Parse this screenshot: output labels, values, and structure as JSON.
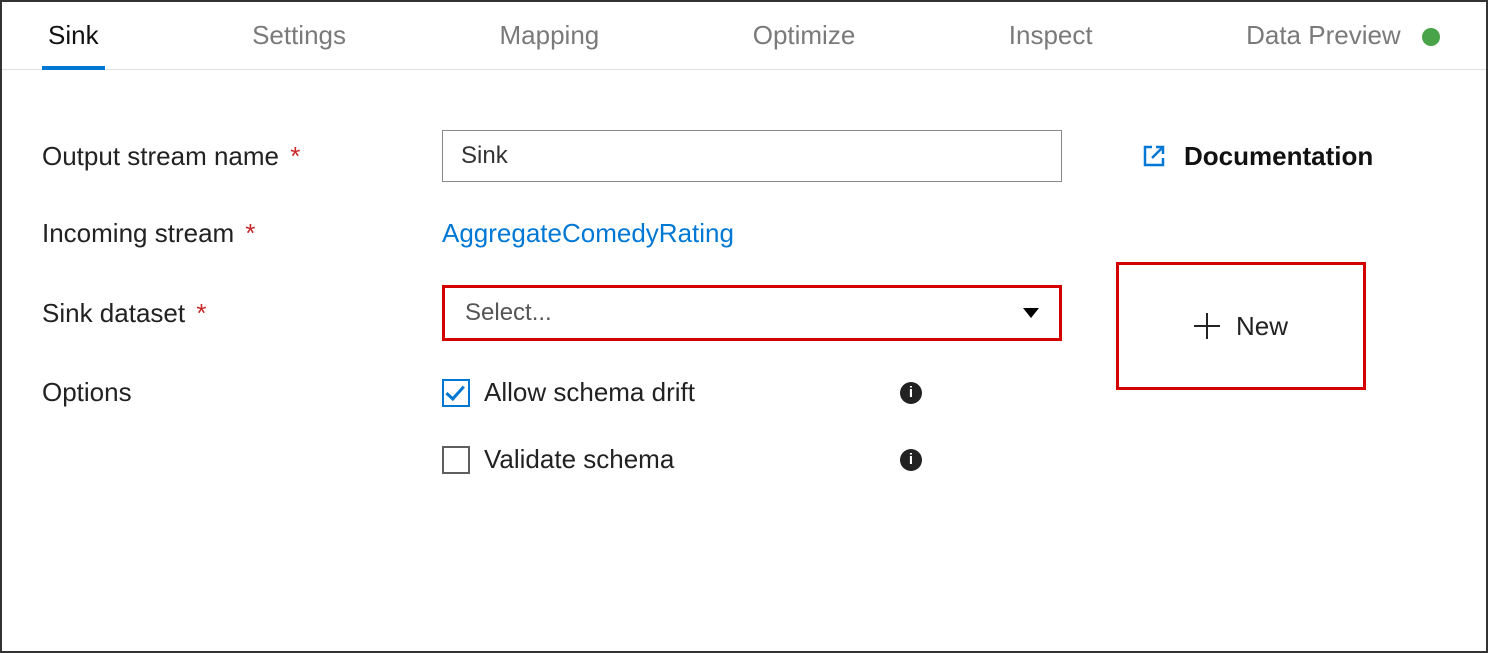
{
  "tabs": {
    "sink": "Sink",
    "settings": "Settings",
    "mapping": "Mapping",
    "optimize": "Optimize",
    "inspect": "Inspect",
    "dataPreview": "Data Preview"
  },
  "form": {
    "outputStreamName": {
      "label": "Output stream name",
      "value": "Sink"
    },
    "incomingStream": {
      "label": "Incoming stream",
      "value": "AggregateComedyRating"
    },
    "sinkDataset": {
      "label": "Sink dataset",
      "placeholder": "Select..."
    },
    "options": {
      "label": "Options",
      "allowSchemaDrift": {
        "label": "Allow schema drift",
        "checked": true
      },
      "validateSchema": {
        "label": "Validate schema",
        "checked": false
      }
    }
  },
  "actions": {
    "newButton": "New",
    "documentation": "Documentation"
  }
}
